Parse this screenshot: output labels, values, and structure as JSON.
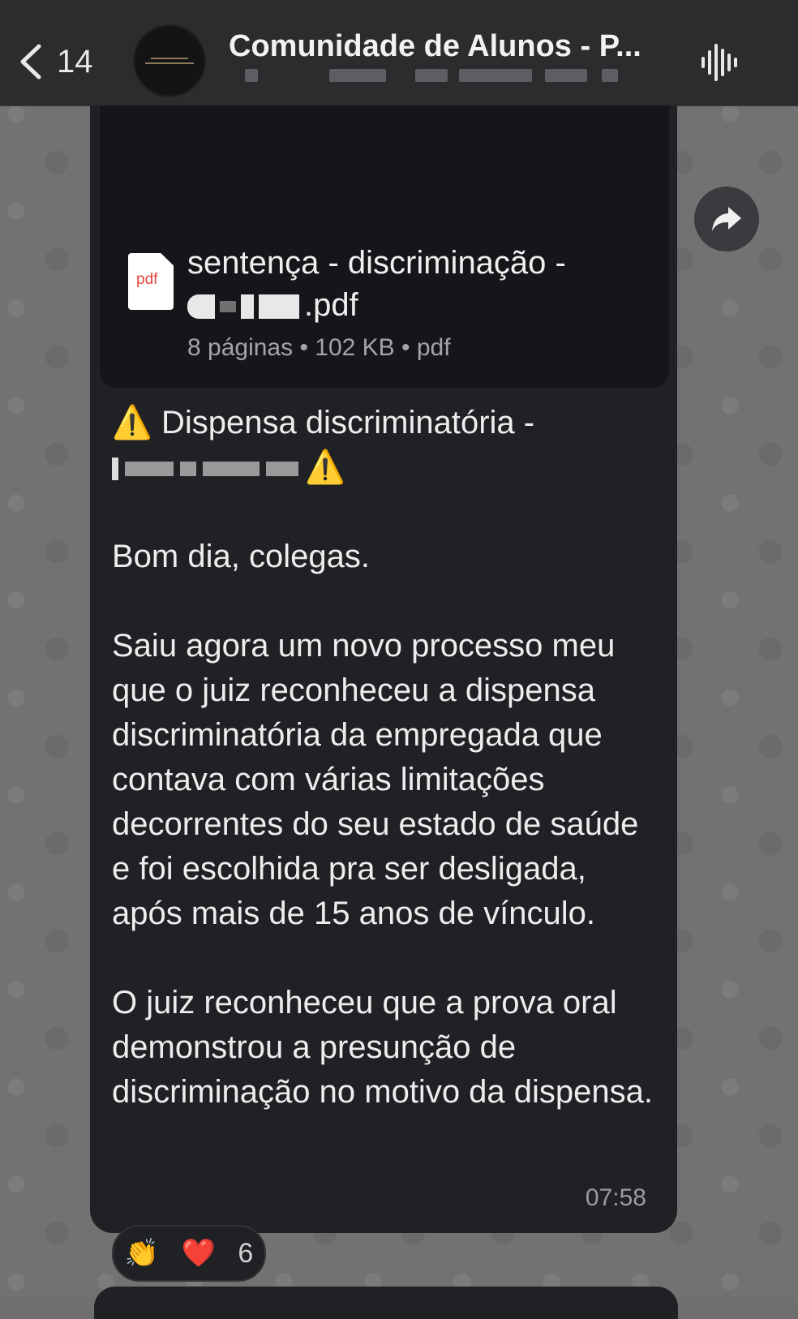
{
  "header": {
    "back_count": "14",
    "title": "Comunidade de Alunos - P..."
  },
  "document": {
    "name_prefix": "sentença - discriminação -",
    "name_suffix": ".pdf",
    "icon_label": "pdf",
    "meta": "8 páginas • 102 KB • pdf"
  },
  "message": {
    "warning_glyph": "⚠️",
    "heading": "Dispensa discriminatória -",
    "greeting": "Bom dia, colegas.",
    "paragraph1": "Saiu agora um novo processo meu que o juiz reconheceu a dispensa discriminatória da empregada que contava com várias limitações decorrentes do seu estado de saúde e foi escolhida pra ser desligada, após mais de 15 anos de vínculo.",
    "paragraph2": "O juiz reconheceu que a prova oral demonstrou a presunção de discriminação no motivo da dispensa.",
    "time": "07:58"
  },
  "reactions": {
    "emoji1": "👏",
    "emoji2": "❤️",
    "count": "6"
  },
  "colors": {
    "header_bg": "#2b2c2e",
    "bubble_bg": "#1f2124",
    "doc_bg": "#151619",
    "pdf_red": "#e0443a",
    "warning_yellow": "#ffcc00"
  }
}
